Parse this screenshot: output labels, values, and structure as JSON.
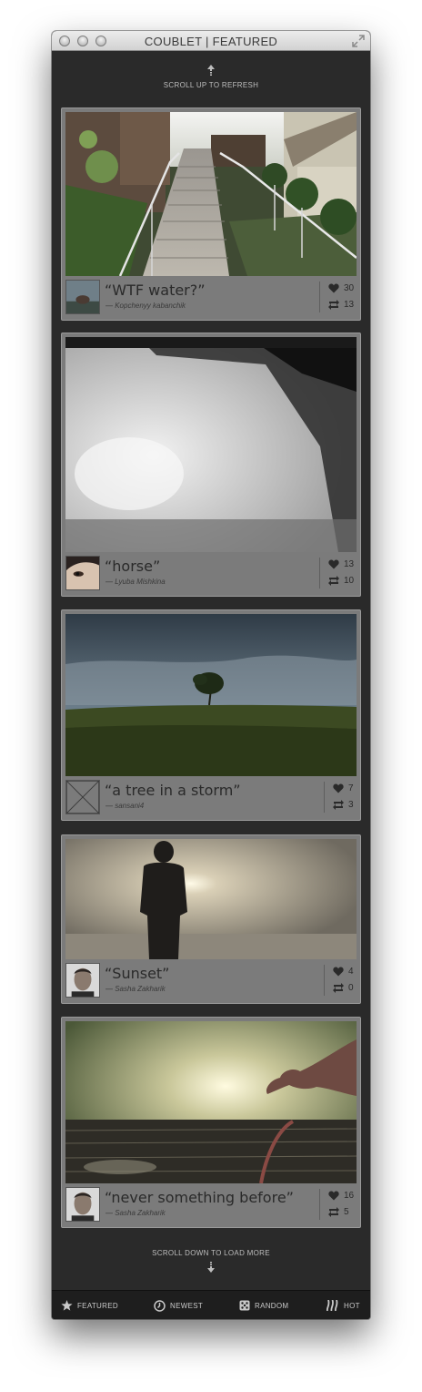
{
  "window": {
    "title": "COUBLET | FEATURED"
  },
  "hints": {
    "refresh": "SCROLL UP TO REFRESH",
    "load_more": "SCROLL DOWN TO LOAD MORE"
  },
  "cards": [
    {
      "caption": "“WTF water?”",
      "author": "— Kopchenyy kabanchik",
      "likes": "30",
      "recoubs": "13"
    },
    {
      "caption": "“horse”",
      "author": "— Lyuba Mishkina",
      "likes": "13",
      "recoubs": "10"
    },
    {
      "caption": "“a tree in a storm”",
      "author": "— sansani4",
      "likes": "7",
      "recoubs": "3"
    },
    {
      "caption": "“Sunset”",
      "author": "— Sasha Zakharik",
      "likes": "4",
      "recoubs": "0"
    },
    {
      "caption": "“never something before”",
      "author": "— Sasha Zakharik",
      "likes": "16",
      "recoubs": "5"
    }
  ],
  "tabs": [
    {
      "label": "FEATURED",
      "icon": "star-icon"
    },
    {
      "label": "NEWEST",
      "icon": "clock-icon"
    },
    {
      "label": "RANDOM",
      "icon": "dice-icon"
    },
    {
      "label": "HOT",
      "icon": "flames-icon"
    }
  ]
}
